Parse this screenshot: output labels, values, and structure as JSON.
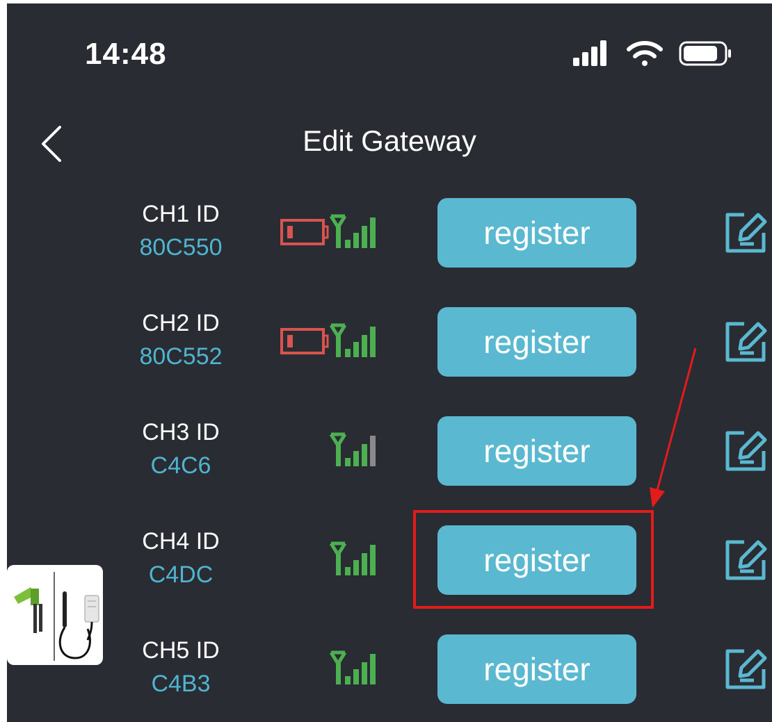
{
  "status_bar": {
    "time": "14:48",
    "icons": [
      "cellular-signal-icon",
      "wifi-icon",
      "battery-icon"
    ]
  },
  "nav": {
    "title": "Edit Gateway",
    "back_icon": "chevron-left-icon"
  },
  "channels": [
    {
      "label": "CH1 ID",
      "id": "80C550",
      "battery": "low",
      "signal_bars": 4,
      "register_label": "register"
    },
    {
      "label": "CH2 ID",
      "id": "80C552",
      "battery": "low",
      "signal_bars": 4,
      "register_label": "register"
    },
    {
      "label": "CH3 ID",
      "id": "C4C6",
      "battery": null,
      "signal_bars": 3,
      "register_label": "register"
    },
    {
      "label": "CH4 ID",
      "id": "C4DC",
      "battery": null,
      "signal_bars": 4,
      "register_label": "register"
    },
    {
      "label": "CH5 ID",
      "id": "C4B3",
      "battery": null,
      "signal_bars": 4,
      "register_label": "register"
    }
  ],
  "colors": {
    "background": "#2a2c33",
    "accent": "#5ab9d0",
    "id_text": "#4fb4cf",
    "signal_green": "#4caf50",
    "signal_gray": "#8a8a8a",
    "battery_low": "#d9534f",
    "annotation_red": "#e31b1b"
  },
  "annotation": {
    "highlighted_channel": "CH4 ID"
  }
}
